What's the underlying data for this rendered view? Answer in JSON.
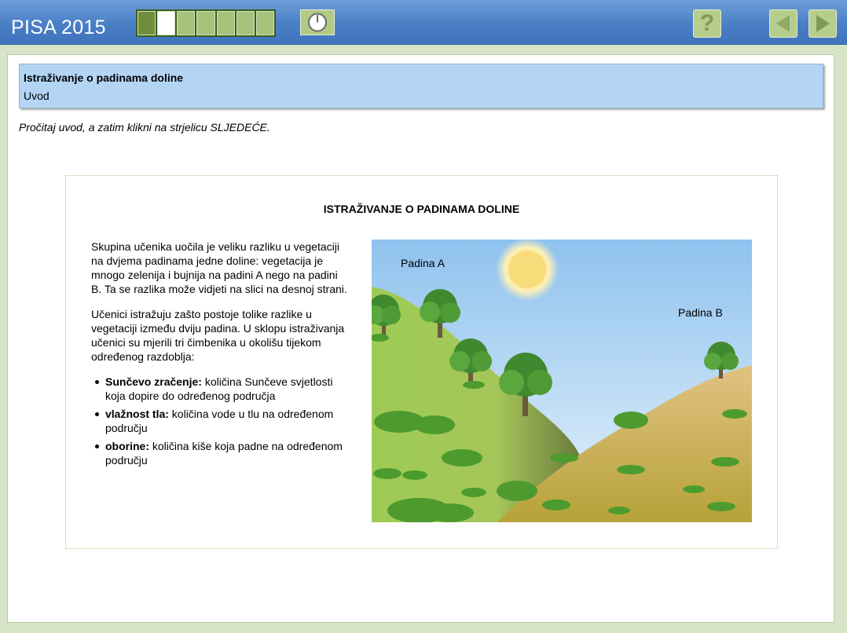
{
  "app": {
    "title": "PISA 2015"
  },
  "progress": {
    "segments": 7,
    "completed": 1,
    "current": 2
  },
  "toolbar": {
    "help_icon": "question-icon",
    "prev_icon": "arrow-left-icon",
    "next_icon": "arrow-right-icon",
    "timer_icon": "timer-icon"
  },
  "header": {
    "title": "Istraživanje o padinama doline",
    "subtitle": "Uvod"
  },
  "instruction": "Pročitaj uvod, a zatim klikni na strjelicu SLJEDEĆE.",
  "stimulus": {
    "title": "ISTRAŽIVANJE O PADINAMA DOLINE",
    "paragraph1": "Skupina učenika uočila je veliku razliku u vegetaciji na dvjema padinama jedne doline: vegetacija je mnogo zelenija i bujnija na padini A nego na padini B. Ta se razlika može vidjeti na slici na desnoj strani.",
    "paragraph2": "Učenici istražuju zašto postoje tolike razlike u vegetaciji između dviju padina. U sklopu istraživanja učenici su mjerili tri čimbenika u okolišu tijekom određenog razdoblja:",
    "factors": [
      {
        "term": "Sunčevo zračenje:",
        "desc": " količina Sunčeve svjetlosti koja dopire do određenog područja"
      },
      {
        "term": "vlažnost tla:",
        "desc": " količina vode u tlu na određenom području"
      },
      {
        "term": "oborine:",
        "desc": " količina kiše koja padne na određenom području"
      }
    ],
    "picture": {
      "label_a": "Padina A",
      "label_b": "Padina B"
    }
  },
  "colors": {
    "topbar": "#4a7fc6",
    "header_bg": "#b3d5f3",
    "frame": "#d7e4c7",
    "button": "#b7cd8d"
  }
}
